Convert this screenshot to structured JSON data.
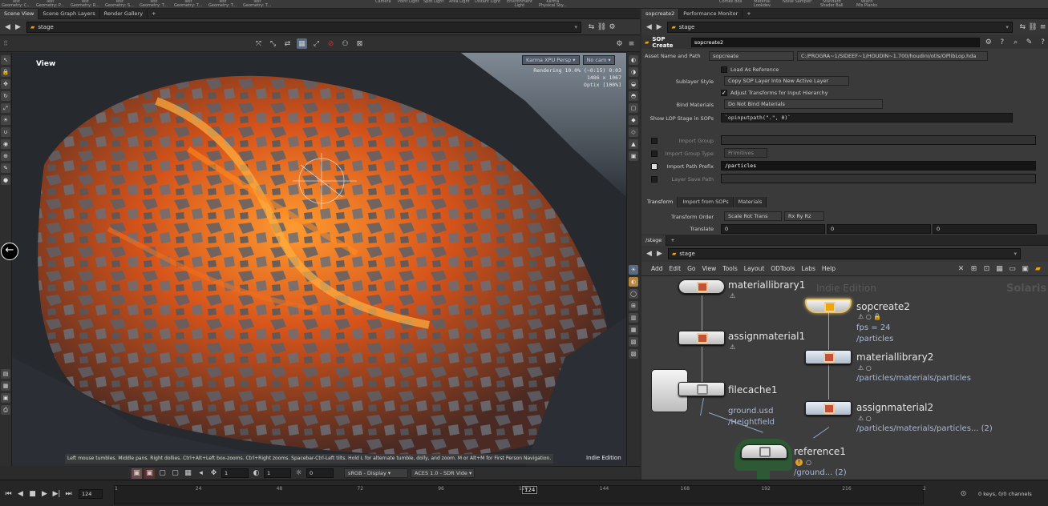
{
  "shelf": {
    "items": [
      {
        "line1": "Test",
        "line2": "Geometry: C..."
      },
      {
        "line1": "Test",
        "line2": "Geometry: P..."
      },
      {
        "line1": "Test",
        "line2": "Geometry: R..."
      },
      {
        "line1": "Test",
        "line2": "Geometry: S..."
      },
      {
        "line1": "Test",
        "line2": "Geometry: T..."
      },
      {
        "line1": "Test",
        "line2": "Geometry: T..."
      },
      {
        "line1": "Test",
        "line2": "Geometry: T..."
      },
      {
        "line1": "Test",
        "line2": "Geometry: T..."
      },
      {
        "line1": "",
        "line2": "Camera"
      },
      {
        "line1": "",
        "line2": "Point Light"
      },
      {
        "line1": "",
        "line2": "Spot Light"
      },
      {
        "line1": "",
        "line2": "Area Light"
      },
      {
        "line1": "",
        "line2": "Distant Light"
      },
      {
        "line1": "Environment",
        "line2": "Light"
      },
      {
        "line1": "Karma",
        "line2": "Physical Sky..."
      },
      {
        "line1": "",
        "line2": "Cornell Box"
      },
      {
        "line1": "Material",
        "line2": "Lookdev"
      },
      {
        "line1": "",
        "line2": "Noise Sampler"
      },
      {
        "line1": "Standard",
        "line2": "Shader Ball"
      },
      {
        "line1": "Veach",
        "line2": "Mis Planks"
      }
    ]
  },
  "left_tabs": {
    "scene_view": "Scene View",
    "scene_graph": "Scene Graph Layers",
    "render_gallery": "Render Gallery",
    "add": "+"
  },
  "left_path": {
    "value": "stage"
  },
  "viewport": {
    "label": "View",
    "renderer": "Karma XPU",
    "camera_mode": "Persp",
    "cam": "No cam",
    "status": "Rendering",
    "progress": "10.0%",
    "time": "(~0:15)",
    "elapsed": "0:03",
    "resolution": "1486 x 1067",
    "engine": "Optix [100%]",
    "hint": "Left mouse tumbles. Middle pans. Right dollies. Ctrl+Alt+Left box-zooms. Ctrl+Right zooms. Spacebar-Ctrl-Left tilts. Hold L for alternate tumble, dolly, and zoom. M or Alt+M for First Person Navigation.",
    "edition": "Indie Edition"
  },
  "viewport_bottom": {
    "field1": "1",
    "field2": "1",
    "field3": "0",
    "colorspace": "sRGB - Display",
    "aces": "ACES 1.0 - SDR Vide"
  },
  "timeline": {
    "current_frame": "124",
    "marker": "124",
    "ticks": [
      "1",
      "24",
      "48",
      "72",
      "96",
      "120",
      "144",
      "168",
      "192",
      "216",
      "2"
    ],
    "keys_status": "0 keys, 0/0 channels"
  },
  "right_tabs": {
    "tab1": "sopcreate2",
    "tab2": "Performance Monitor",
    "add": "+"
  },
  "right_path": {
    "value": "stage"
  },
  "parm_header": {
    "type": "SOP Create",
    "name": "sopcreate2"
  },
  "parms": {
    "asset_label": "Asset Name and Path",
    "asset_name": "sopcreate",
    "asset_path": "C:/PROGRA~1/SIDEEF~1/HOUDIN~1.700/houdini/otls/OPlibLop.hda",
    "load_ref": "Load As Reference",
    "sublayer_label": "Sublayer Style",
    "sublayer_value": "Copy SOP Layer Into New Active Layer",
    "adjust_xform": "Adjust Transforms for Input Hierarchy",
    "bind_label": "Bind Materials",
    "bind_value": "Do Not Bind Materials",
    "show_lop_label": "Show LOP Stage in SOPs",
    "show_lop_value": "`opinputpath(\".\", 0)`",
    "import_group": "Import Group",
    "import_group_type": "Import Group Type",
    "import_group_type_value": "Primitives",
    "import_prefix": "Import Path Prefix",
    "import_prefix_value": "/particles",
    "layer_save": "Layer Save Path",
    "subtabs": [
      "Transform",
      "Import from SOPs",
      "Materials"
    ],
    "transform_order_label": "Transform Order",
    "transform_order_1": "Scale Rot Trans",
    "transform_order_2": "Rx Ry Rz",
    "translate_label": "Translate",
    "translate": [
      "0",
      "0",
      "0"
    ]
  },
  "net_tabs": {
    "tab1": "/stage",
    "add": "+"
  },
  "net_path": {
    "value": "stage"
  },
  "net_menu": [
    "Add",
    "Edit",
    "Go",
    "View",
    "Tools",
    "Layout",
    "ODTools",
    "Labs",
    "Help"
  ],
  "network": {
    "watermark_edition": "Indie Edition",
    "watermark_context": "Solaris",
    "nodes": {
      "matlib1": {
        "name": "materiallibrary1"
      },
      "assign1": {
        "name": "assignmaterial1"
      },
      "filecache1": {
        "name": "filecache1",
        "sub1": "ground.usd",
        "sub2": "/Heightfield"
      },
      "sopcreate2": {
        "name": "sopcreate2",
        "sub1": "fps = 24",
        "sub2": "/particles"
      },
      "matlib2": {
        "name": "materiallibrary2",
        "sub1": "/particles/materials/particles"
      },
      "assign2": {
        "name": "assignmaterial2",
        "sub1": "/particles/materials/particles... (2)"
      },
      "reference1": {
        "name": "reference1",
        "sub1": "/ground... (2)"
      }
    }
  },
  "colors": {
    "accent": "#f0a500",
    "lava": "#e8641a",
    "selected_node": "#e6c36a",
    "wire": "#8fa6c5"
  }
}
